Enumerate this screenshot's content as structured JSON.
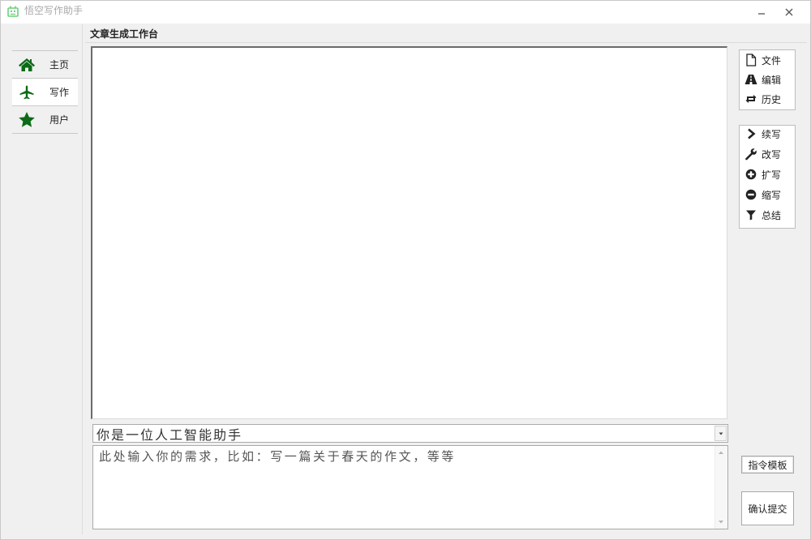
{
  "window": {
    "title": "悟空写作助手"
  },
  "sidebar": {
    "items": [
      {
        "label": "主页",
        "icon": "home-icon"
      },
      {
        "label": "写作",
        "icon": "airplane-icon",
        "active": true
      },
      {
        "label": "用户",
        "icon": "star-icon"
      }
    ]
  },
  "main": {
    "title": "文章生成工作台",
    "editor_text": "",
    "role_select": {
      "value": "你是一位人工智能助手"
    },
    "prompt": {
      "value": "",
      "placeholder": "此处输入你的需求，比如：写一篇关于春天的作文，等等"
    }
  },
  "toolbar_top": [
    {
      "label": "文件",
      "icon": "file-icon"
    },
    {
      "label": "编辑",
      "icon": "road-icon"
    },
    {
      "label": "历史",
      "icon": "retweet-icon"
    }
  ],
  "toolbar_actions": [
    {
      "label": "续写",
      "icon": "chevron-right-icon"
    },
    {
      "label": "改写",
      "icon": "wrench-icon"
    },
    {
      "label": "扩写",
      "icon": "plus-circle-icon"
    },
    {
      "label": "缩写",
      "icon": "minus-circle-icon"
    },
    {
      "label": "总结",
      "icon": "filter-icon"
    }
  ],
  "buttons": {
    "template": "指令模板",
    "submit": "确认提交"
  },
  "colors": {
    "icon_green": "#0b6b17",
    "app_icon_green": "#6cd17a"
  }
}
